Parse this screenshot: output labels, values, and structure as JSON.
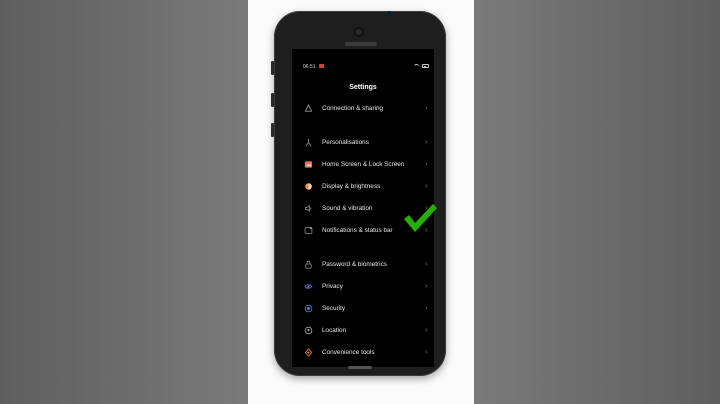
{
  "status_bar": {
    "time": "06:51"
  },
  "header": {
    "title": "Settings"
  },
  "settings": {
    "items": [
      {
        "label": "Connection & sharing",
        "icon": "connection-sharing-icon",
        "color": "#9a9a9a"
      },
      {
        "label": "Personalisations",
        "icon": "personalisations-icon",
        "color": "#9a9a9a"
      },
      {
        "label": "Home Screen & Lock Screen",
        "icon": "home-lock-screen-icon",
        "color": "#e5745a"
      },
      {
        "label": "Display & brightness",
        "icon": "display-brightness-icon",
        "color": "#f08c3c"
      },
      {
        "label": "Sound & vibration",
        "icon": "sound-vibration-icon",
        "color": "#9a9a9a"
      },
      {
        "label": "Notifications & status bar",
        "icon": "notifications-status-bar-icon",
        "color": "#9a9a9a"
      },
      {
        "label": "Password & biometrics",
        "icon": "lock-icon",
        "color": "#9a9a9a"
      },
      {
        "label": "Privacy",
        "icon": "privacy-eye-icon",
        "color": "#6f6fe0"
      },
      {
        "label": "Security",
        "icon": "shield-icon",
        "color": "#5aa0ff"
      },
      {
        "label": "Location",
        "icon": "location-pin-icon",
        "color": "#bdbdbd"
      },
      {
        "label": "Convenience tools",
        "icon": "convenience-tools-icon",
        "color": "#f08c3c"
      }
    ]
  },
  "overlay": {
    "checkmark_color": "#23b000",
    "checkmark_icon": "checkmark-icon"
  }
}
